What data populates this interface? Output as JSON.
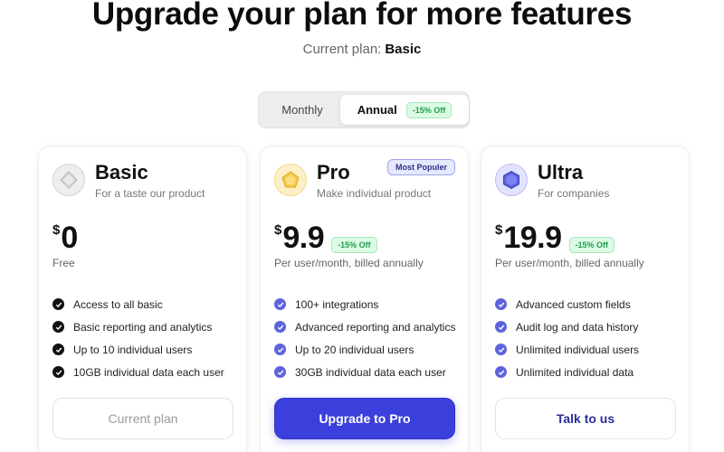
{
  "header": {
    "title": "Upgrade your plan for more features",
    "current_plan_label": "Current plan:",
    "current_plan_value": "Basic"
  },
  "billing_toggle": {
    "monthly_label": "Monthly",
    "annual_label": "Annual",
    "annual_badge": "-15% Off",
    "selected": "Annual"
  },
  "plans": [
    {
      "name": "Basic",
      "description": "For a taste our product",
      "icon": "diamond-gray-icon",
      "currency": "$",
      "price": "0",
      "price_note": "Free",
      "features": [
        "Access to all basic",
        "Basic reporting and analytics",
        "Up to 10 individual users",
        "10GB individual data each user"
      ],
      "cta": "Current plan"
    },
    {
      "name": "Pro",
      "description": "Make individual product",
      "icon": "pentagon-gold-icon",
      "badge": "Most Populer",
      "currency": "$",
      "price": "9.9",
      "discount": "-15% Off",
      "price_note": "Per user/month, billed annually",
      "features": [
        "100+ integrations",
        "Advanced reporting and analytics",
        "Up to 20 individual users",
        "30GB individual data each user"
      ],
      "cta": "Upgrade to Pro"
    },
    {
      "name": "Ultra",
      "description": "For companies",
      "icon": "hexagon-blue-icon",
      "currency": "$",
      "price": "19.9",
      "discount": "-15% Off",
      "price_note": "Per user/month, billed annually",
      "features": [
        "Advanced custom fields",
        "Audit log and data history",
        "Unlimited individual users",
        "Unlimited individual data"
      ],
      "cta": "Talk to us"
    }
  ],
  "colors": {
    "primary": "#3b3fdb",
    "check_basic": "#111111",
    "check_paid": "#5d63dc",
    "discount_bg": "#dcfbe5",
    "discount_text": "#1f9d4c"
  }
}
